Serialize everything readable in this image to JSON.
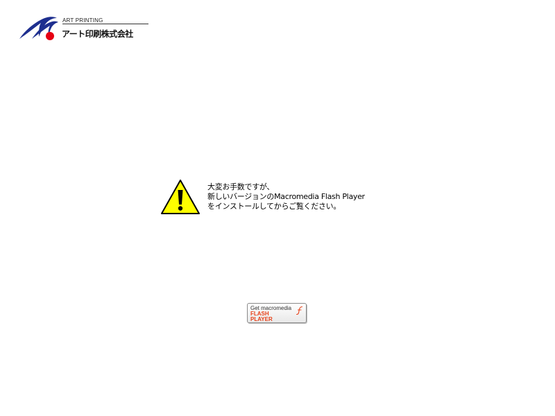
{
  "header": {
    "company_en": "ART PRINTING",
    "company_jp": "アート印刷株式会社"
  },
  "warning": {
    "icon": "warning-icon",
    "lines": [
      "大変お手数ですが、",
      "新しいバージョンのMacromedia Flash Player",
      "をインストールしてからご覧ください。"
    ]
  },
  "flash_badge": {
    "get_label": "Get macromedia",
    "name_line1": "FLASH",
    "name_line2": "PLAYER",
    "icon": "flash-f-icon"
  },
  "colors": {
    "logo_blue": "#1e2f8f",
    "logo_red": "#e60012",
    "warning_yellow": "#ffff00",
    "flash_orange": "#e8421a"
  }
}
